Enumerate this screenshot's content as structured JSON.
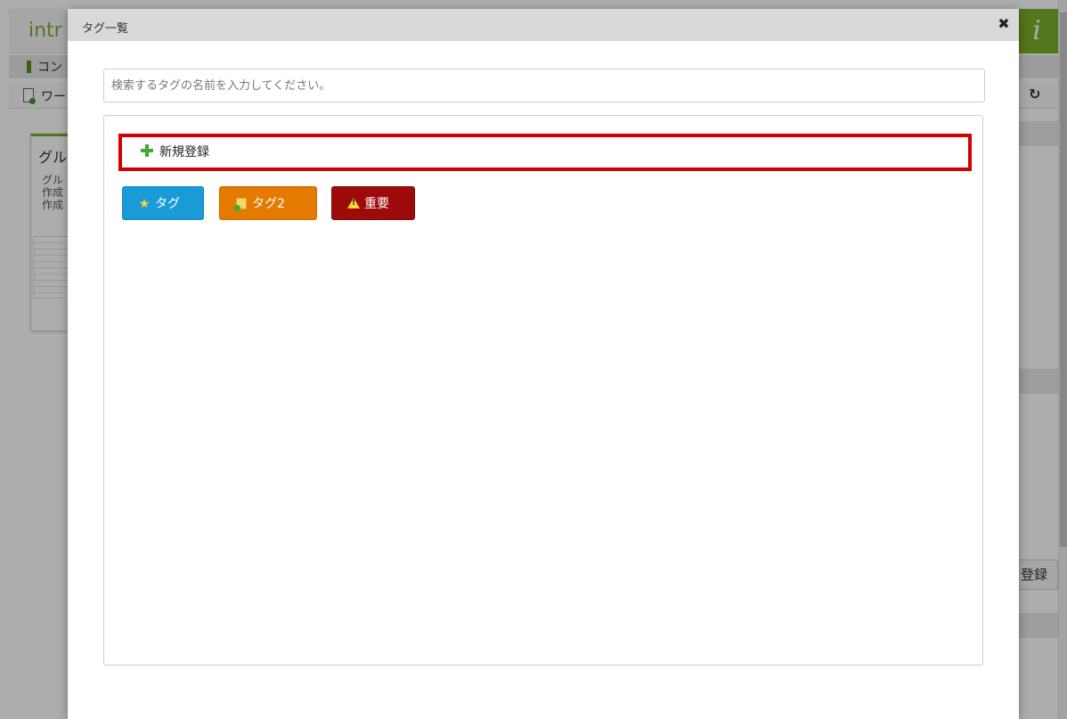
{
  "background": {
    "brand": "intr",
    "menu_item_1": "コン",
    "menu_item_2": "ワー",
    "card_title": "グル",
    "card_lines": [
      "グル",
      "作成",
      "作成"
    ],
    "register_button": "登録",
    "refresh_icon": "refresh-icon"
  },
  "modal": {
    "title": "タグ一覧",
    "close_icon": "close-icon"
  },
  "search": {
    "placeholder": "検索するタグの名前を入力してください。",
    "value": ""
  },
  "new_registration": {
    "label": "新規登録",
    "icon": "plus-icon",
    "highlight_color": "#d40000"
  },
  "tags": [
    {
      "label": "タグ",
      "icon": "star-icon",
      "color": "#1a9bd8"
    },
    {
      "label": "タグ2",
      "icon": "note-icon",
      "color": "#e57a00"
    },
    {
      "label": "重要",
      "icon": "warning-icon",
      "color": "#9c0a0a"
    }
  ]
}
